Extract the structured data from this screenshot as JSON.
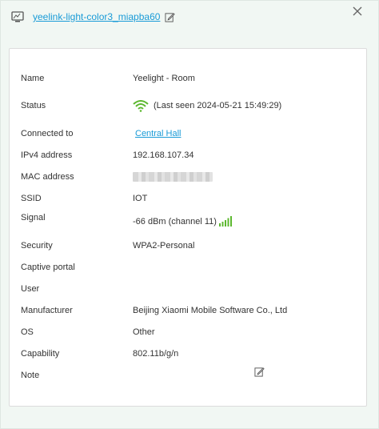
{
  "header": {
    "device_name": "yeelink-light-color3_miapba60",
    "icon": "device-icon",
    "edit_icon": "edit-icon",
    "close_icon": "close-icon"
  },
  "details": {
    "name_label": "Name",
    "name_value": "Yeelight - Room",
    "status_label": "Status",
    "status_value": "(Last seen 2024-05-21 15:49:29)",
    "connected_label": "Connected to",
    "connected_value": "Central Hall",
    "ipv4_label": "IPv4 address",
    "ipv4_value": "192.168.107.34",
    "mac_label": "MAC address",
    "ssid_label": "SSID",
    "ssid_value": "IOT",
    "signal_label": "Signal",
    "signal_value": "-66 dBm (channel 11)",
    "security_label": "Security",
    "security_value": "WPA2-Personal",
    "captive_label": "Captive portal",
    "user_label": "User",
    "manufacturer_label": "Manufacturer",
    "manufacturer_value": "Beijing Xiaomi Mobile Software Co., Ltd",
    "os_label": "OS",
    "os_value": "Other",
    "capability_label": "Capability",
    "capability_value": "802.11b/g/n",
    "note_label": "Note"
  },
  "colors": {
    "accent": "#1a9bd7",
    "signal_green": "#5cb82f",
    "panel_bg": "#f1f7f3"
  }
}
